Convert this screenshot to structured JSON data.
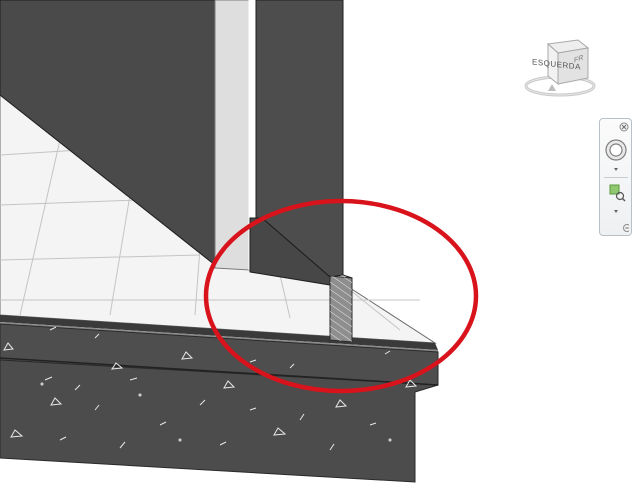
{
  "colors": {
    "wall_face": "#4a4a4a",
    "wall_edge": "#1e1e1e",
    "slab_top": "#f3f3f3",
    "grid_line": "#bdbdbd",
    "foundation": "#505050",
    "annotation_circle": "#d8131c",
    "navbar_accent": "#6aa84f"
  },
  "viewcube": {
    "face_label": "ESQUERDA",
    "side_label": "FR"
  },
  "navbar": {
    "icons": [
      "close-icon",
      "steering-wheel-icon",
      "dropdown-arrow-icon",
      "zoom-region-icon",
      "dropdown-arrow-icon",
      "options-icon"
    ]
  },
  "markup": {
    "shape": "ellipse",
    "color": "#d8131c"
  }
}
